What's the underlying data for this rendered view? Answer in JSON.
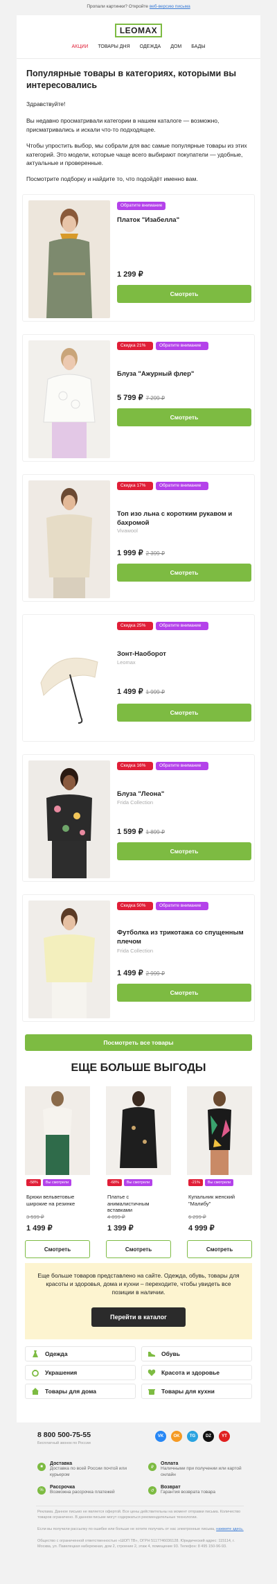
{
  "preheader": {
    "text": "Пропали картинки? Откройте",
    "link": "веб-версию письма"
  },
  "brand": {
    "logo": "LEOMAX",
    "accent": "#7dbb42",
    "sale": "#e01e37",
    "attention": "#b442ea"
  },
  "nav": [
    "АКЦИИ",
    "ТОВАРЫ ДНЯ",
    "ОДЕЖДА",
    "ДОМ",
    "БАДЫ"
  ],
  "headline": "Популярные товары в категориях, которыми вы интересовались",
  "greeting": "Здравствуйте!",
  "para1": "Вы недавно просматривали категории в нашем каталоге — возможно, присматривались и искали что-то подходящее.",
  "para2": "Чтобы упростить выбор, мы собрали для вас самые популярные товары из этих категорий. Это модели, которые чаще всего выбирают покупатели — удобные, актуальные и проверенные.",
  "para3": "Посмотрите подборку и найдите то, что подойдёт именно вам.",
  "attention_label": "Обратите внимание",
  "view_label": "Смотреть",
  "products": [
    {
      "name": "Платок \"Изабелла\"",
      "brand": "",
      "price": "1 299 ₽",
      "old": "",
      "sale": ""
    },
    {
      "name": "Блуза \"Ажурный флер\"",
      "brand": "",
      "price": "5 799 ₽",
      "old": "7 299 ₽",
      "sale": "Скидка 21%"
    },
    {
      "name": "Топ изо льна с коротким рукавом и бахромой",
      "brand": "Vivawool",
      "price": "1 999 ₽",
      "old": "2 399 ₽",
      "sale": "Скидка 17%"
    },
    {
      "name": "Зонт-Наоборот",
      "brand": "Leomax",
      "price": "1 499 ₽",
      "old": "1 999 ₽",
      "sale": "Скидка 25%"
    },
    {
      "name": "Блуза \"Леона\"",
      "brand": "Frida Collection",
      "price": "1 599 ₽",
      "old": "1 899 ₽",
      "sale": "Скидка 16%"
    },
    {
      "name": "Футболка из трикотажа со спущенным плечом",
      "brand": "Frida Collection",
      "price": "1 499 ₽",
      "old": "2 999 ₽",
      "sale": "Скидка 50%"
    }
  ],
  "all_button": "Посмотреть все товары",
  "more_title": "ЕЩЕ БОЛЬШЕ ВЫГОДЫ",
  "mini_tag": "Вы смотрели",
  "minis": [
    {
      "name": "Брюки вельветовые широкие на резинке",
      "sale": "-58%",
      "old": "3 599 ₽",
      "price": "1 499 ₽"
    },
    {
      "name": "Платье с анималистичным вставками",
      "sale": "-68%",
      "old": "4 899 ₽",
      "price": "1 399 ₽"
    },
    {
      "name": "Купальник женский \"Малибу\"",
      "sale": "-21%",
      "old": "6 299 ₽",
      "price": "4 999 ₽"
    }
  ],
  "promo": {
    "text": "Еще больше товаров представлено на сайте. Одежда, обувь, товары для красоты и здоровья, дома и кухни – переходите, чтобы увидеть все позиции в наличии.",
    "button": "Перейти в каталог"
  },
  "categories": [
    "Одежда",
    "Обувь",
    "Украшения",
    "Красота и здоровье",
    "Товары для дома",
    "Товары для кухни"
  ],
  "footer": {
    "phone": "8 800 500-75-55",
    "phone_note": "Бесплатный звонок по России",
    "socials": [
      "VK",
      "OK",
      "TG",
      "DZ",
      "YT"
    ],
    "info": [
      {
        "title": "Доставка",
        "text": "Доставка по всей России почтой или курьером"
      },
      {
        "title": "Оплата",
        "text": "Наличными при получении или картой онлайн"
      },
      {
        "title": "Рассрочка",
        "text": "Возможна рассрочка платежей"
      },
      {
        "title": "Возврат",
        "text": "Гарантия возврата товара"
      }
    ],
    "legal1": "Реклама. Данное письмо не является офертой. Все цены действительны на момент отправки письма. Количество товаров ограничено. В данном письме могут содержаться рекомендательные технологии.",
    "legal2": "Если вы получили рассылку по ошибке или больше не хотите получать от нас электронные письма,",
    "unsubscribe": "нажмите здесь.",
    "legal3": "Общество с ограниченной ответственностью «ШОП ТВ», ОГРН 5117746036128. Юридический адрес: 115114, г. Москва, ул. Павелецкая набережная, дом 2, строение 2, этаж 4, помещение 93. Телефон: 8 495 150-96-93."
  }
}
